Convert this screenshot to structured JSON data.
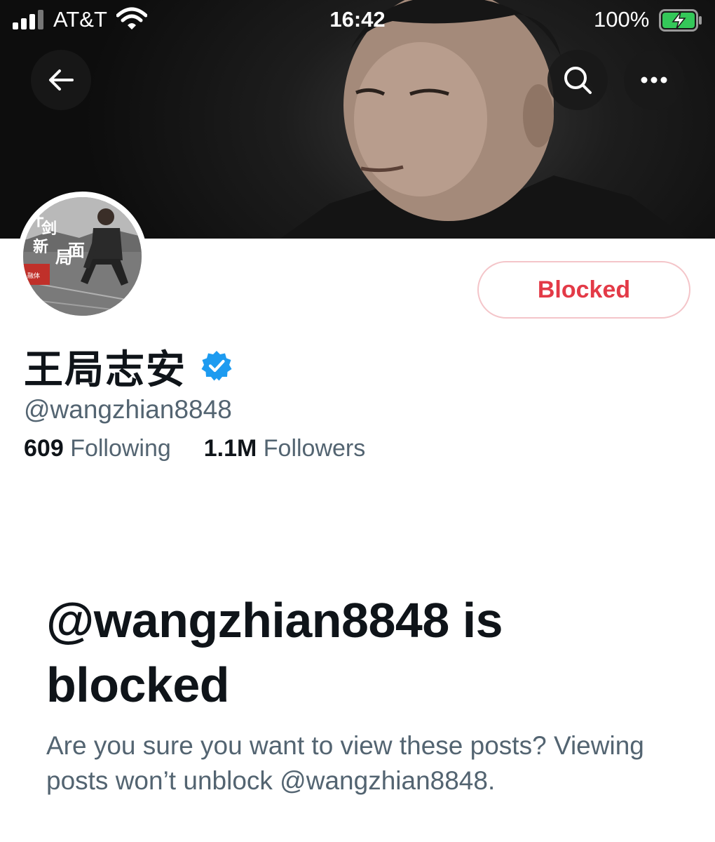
{
  "status_bar": {
    "carrier": "AT&T",
    "time": "16:42",
    "battery": "100%"
  },
  "header": {
    "back_icon": "arrow-left-icon",
    "search_icon": "search-icon",
    "more_icon": "ellipsis-icon"
  },
  "profile": {
    "display_name": "王局志安",
    "verified": true,
    "handle": "@wangzhian8848",
    "following_count": "609",
    "following_label": "Following",
    "followers_count": "1.1M",
    "followers_label": "Followers",
    "relationship_button": "Blocked"
  },
  "avatar_caption": {
    "l1": "开",
    "l2": "剑",
    "l3": "新",
    "l4": "局",
    "l5": "面",
    "small": "融体"
  },
  "blocked_notice": {
    "title": "@wangzhian8848 is blocked",
    "message": "Are you sure you want to view these posts? Viewing posts won’t unblock @wangzhian8848."
  },
  "colors": {
    "blocked_red": "#e33a47",
    "verified_blue": "#1d9bf0",
    "secondary_text": "#536471"
  }
}
